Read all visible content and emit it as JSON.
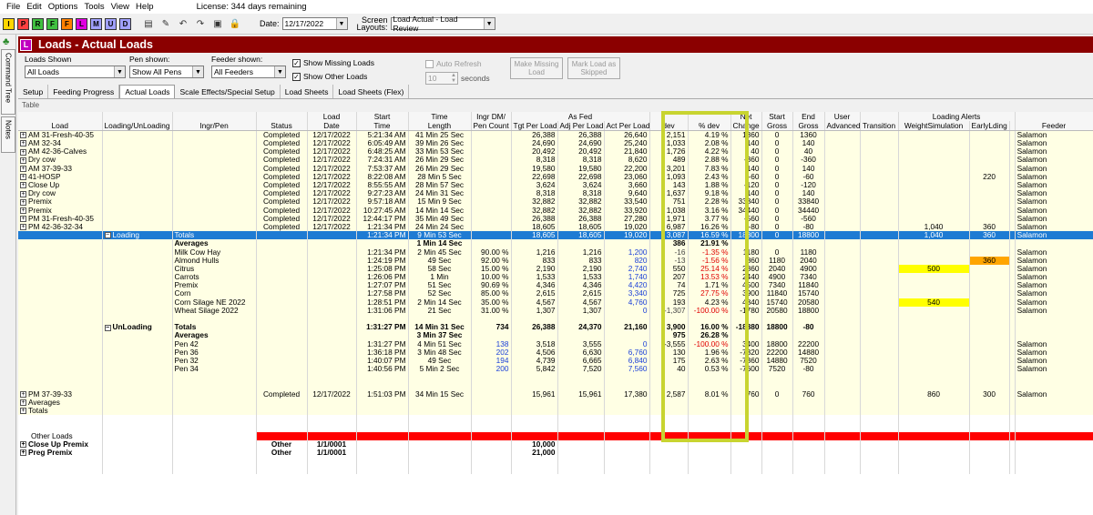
{
  "menu": {
    "file": "File",
    "edit": "Edit",
    "options": "Options",
    "tools": "Tools",
    "view": "View",
    "help": "Help",
    "license": "License: 344 days remaining"
  },
  "toolbar": {
    "buttons": [
      "I",
      "P",
      "R",
      "F",
      "F",
      "L",
      "M",
      "U",
      "D"
    ],
    "date_label": "Date:",
    "date_value": "12/17/2022",
    "screen_label1": "Screen",
    "screen_label2": "Layouts:",
    "screen_value": "Load Actual - Load Review"
  },
  "sidebar": {
    "command_tree": "Command Tree",
    "notes": "Notes"
  },
  "window": {
    "title": "Loads - Actual Loads",
    "icon": "L"
  },
  "filters": {
    "loads_shown_label": "Loads Shown",
    "loads_shown_value": "All Loads",
    "pen_shown_label": "Pen shown:",
    "pen_shown_value": "Show All Pens",
    "feeder_shown_label": "Feeder shown:",
    "feeder_shown_value": "All Feeders",
    "show_missing": "Show Missing Loads",
    "show_other": "Show Other Loads",
    "auto_refresh": "Auto Refresh",
    "interval_value": "10",
    "seconds": "seconds",
    "make_missing": "Make Missing Load",
    "mark_skipped": "Mark Load as Skipped"
  },
  "tabs": [
    "Setup",
    "Feeding Progress",
    "Actual Loads",
    "Scale Effects/Special Setup",
    "Load Sheets",
    "Load Sheets (Flex)"
  ],
  "section_label": "Table",
  "columns": {
    "h1": [
      "",
      "",
      "",
      "",
      "Load",
      "Start",
      "Time",
      "Ingr DM/",
      "As Fed",
      "",
      "",
      "",
      "Net",
      "Start",
      "End",
      "User",
      "",
      "Loading Alerts",
      "",
      "",
      "",
      ""
    ],
    "h2": [
      "Load",
      "Loading/UnLoading",
      "Ingr/Pen",
      "Status",
      "Date",
      "Time",
      "Length",
      "Pen Count",
      "Tgt Per Load",
      "Adj Per Load",
      "Act Per Load",
      "dev",
      "% dev",
      "Change",
      "Gross",
      "Gross",
      "Advanced",
      "Transition",
      "WeightSimulation",
      "EarlyLding",
      "",
      "Feeder"
    ]
  },
  "loads": [
    {
      "name": "AM 31-Fresh-40-35",
      "status": "Completed",
      "date": "12/17/2022",
      "time": "5:21:34 AM",
      "length": "41 Min 25 Sec",
      "tgt": "26,388",
      "adj": "26,388",
      "act": "26,640",
      "dev": "2,151",
      "pdev": "4.19 %",
      "net": "1360",
      "sg": "0",
      "eg": "1360",
      "feeder": "Salamon"
    },
    {
      "name": "AM 32-34",
      "status": "Completed",
      "date": "12/17/2022",
      "time": "6:05:49 AM",
      "length": "39 Min 26 Sec",
      "tgt": "24,690",
      "adj": "24,690",
      "act": "25,240",
      "dev": "1,033",
      "pdev": "2.08 %",
      "net": "140",
      "sg": "0",
      "eg": "140",
      "feeder": "Salamon"
    },
    {
      "name": "AM 42-36-Calves",
      "status": "Completed",
      "date": "12/17/2022",
      "time": "6:48:25 AM",
      "length": "33 Min 53 Sec",
      "tgt": "20,492",
      "adj": "20,492",
      "act": "21,840",
      "dev": "1,726",
      "pdev": "4.22 %",
      "net": "40",
      "sg": "0",
      "eg": "40",
      "feeder": "Salamon"
    },
    {
      "name": "Dry cow",
      "status": "Completed",
      "date": "12/17/2022",
      "time": "7:24:31 AM",
      "length": "26 Min 29 Sec",
      "tgt": "8,318",
      "adj": "8,318",
      "act": "8,620",
      "dev": "489",
      "pdev": "2.88 %",
      "net": "-360",
      "sg": "0",
      "eg": "-360",
      "feeder": "Salamon"
    },
    {
      "name": "AM 37-39-33",
      "status": "Completed",
      "date": "12/17/2022",
      "time": "7:53:37 AM",
      "length": "26 Min 29 Sec",
      "tgt": "19,580",
      "adj": "19,580",
      "act": "22,200",
      "dev": "3,201",
      "pdev": "7.83 %",
      "net": "140",
      "sg": "0",
      "eg": "140",
      "feeder": "Salamon"
    },
    {
      "name": "41-HOSP",
      "status": "Completed",
      "date": "12/17/2022",
      "time": "8:22:08 AM",
      "length": "28 Min 5 Sec",
      "tgt": "22,698",
      "adj": "22,698",
      "act": "23,060",
      "dev": "1,093",
      "pdev": "2.43 %",
      "net": "-60",
      "sg": "0",
      "eg": "-60",
      "early": "220",
      "feeder": "Salamon"
    },
    {
      "name": "Close Up",
      "status": "Completed",
      "date": "12/17/2022",
      "time": "8:55:55 AM",
      "length": "28 Min 57 Sec",
      "tgt": "3,624",
      "adj": "3,624",
      "act": "3,660",
      "dev": "143",
      "pdev": "1.88 %",
      "net": "-120",
      "sg": "0",
      "eg": "-120",
      "feeder": "Salamon"
    },
    {
      "name": "Dry cow",
      "status": "Completed",
      "date": "12/17/2022",
      "time": "9:27:23 AM",
      "length": "24 Min 31 Sec",
      "tgt": "8,318",
      "adj": "8,318",
      "act": "9,640",
      "dev": "1,637",
      "pdev": "9.18 %",
      "net": "140",
      "sg": "0",
      "eg": "140",
      "feeder": "Salamon"
    },
    {
      "name": "Premix",
      "status": "Completed",
      "date": "12/17/2022",
      "time": "9:57:18 AM",
      "length": "15 Min 9 Sec",
      "tgt": "32,882",
      "adj": "32,882",
      "act": "33,540",
      "dev": "751",
      "pdev": "2.28 %",
      "net": "33840",
      "sg": "0",
      "eg": "33840",
      "feeder": "Salamon"
    },
    {
      "name": "Premix",
      "status": "Completed",
      "date": "12/17/2022",
      "time": "10:27:45 AM",
      "length": "14 Min 14 Sec",
      "tgt": "32,882",
      "adj": "32,882",
      "act": "33,920",
      "dev": "1,038",
      "pdev": "3.16 %",
      "net": "34440",
      "sg": "0",
      "eg": "34440",
      "feeder": "Salamon"
    },
    {
      "name": "PM 31-Fresh-40-35",
      "status": "Completed",
      "date": "12/17/2022",
      "time": "12:44:17 PM",
      "length": "35 Min 49 Sec",
      "tgt": "26,388",
      "adj": "26,388",
      "act": "27,280",
      "dev": "1,971",
      "pdev": "3.77 %",
      "net": "-560",
      "sg": "0",
      "eg": "-560",
      "feeder": "Salamon"
    },
    {
      "name": "PM 42-36-32-34",
      "status": "Completed",
      "date": "12/17/2022",
      "time": "1:21:34 PM",
      "length": "24 Min 24 Sec",
      "tgt": "18,605",
      "adj": "18,605",
      "act": "19,020",
      "dev": "6,987",
      "pdev": "16.26 %",
      "net": "-80",
      "sg": "0",
      "eg": "-80",
      "wsim": "1,040",
      "early": "360",
      "feeder": "Salamon"
    }
  ],
  "loading": {
    "label": "Loading",
    "totals": "Totals",
    "time": "1:21:34 PM",
    "length": "9 Min 53 Sec",
    "tgt": "18,605",
    "adj": "18,605",
    "act": "19,020",
    "dev": "3,087",
    "pdev": "16.59 %",
    "net": "18800",
    "sg": "0",
    "eg": "18800",
    "wsim": "1,040",
    "early": "360",
    "feeder": "Salamon",
    "avg_label": "Averages",
    "avg_length": "1 Min 14 Sec",
    "avg_dev": "386",
    "avg_pdev": "21.91 %"
  },
  "ingredients": [
    {
      "name": "Milk Cow Hay",
      "time": "1:21:34 PM",
      "length": "2 Min 45 Sec",
      "pct": "90.00 %",
      "tgt": "1,216",
      "adj": "1,216",
      "act": "1,200",
      "dev": "-16",
      "pdev": "-1.35 %",
      "net": "1180",
      "sg": "0",
      "eg": "1180",
      "feeder": "Salamon"
    },
    {
      "name": "Almond Hulls",
      "time": "1:24:19 PM",
      "length": "49 Sec",
      "pct": "92.00 %",
      "tgt": "833",
      "adj": "833",
      "act": "820",
      "dev": "-13",
      "pdev": "-1.56 %",
      "net": "860",
      "sg": "1180",
      "eg": "2040",
      "early": "360",
      "feeder": "Salamon"
    },
    {
      "name": "Citrus",
      "time": "1:25:08 PM",
      "length": "58 Sec",
      "pct": "15.00 %",
      "tgt": "2,190",
      "adj": "2,190",
      "act": "2,740",
      "dev": "550",
      "pdev": "25.14 %",
      "net": "2860",
      "sg": "2040",
      "eg": "4900",
      "wsim": "500",
      "feeder": "Salamon"
    },
    {
      "name": "Carrots",
      "time": "1:26:06 PM",
      "length": "1 Min",
      "pct": "10.00 %",
      "tgt": "1,533",
      "adj": "1,533",
      "act": "1,740",
      "dev": "207",
      "pdev": "13.53 %",
      "net": "2440",
      "sg": "4900",
      "eg": "7340",
      "feeder": "Salamon"
    },
    {
      "name": "Premix",
      "time": "1:27:07 PM",
      "length": "51 Sec",
      "pct": "90.69 %",
      "tgt": "4,346",
      "adj": "4,346",
      "act": "4,420",
      "dev": "74",
      "pdev": "1.71 %",
      "net": "4500",
      "sg": "7340",
      "eg": "11840",
      "feeder": "Salamon"
    },
    {
      "name": "Corn",
      "time": "1:27:58 PM",
      "length": "52 Sec",
      "pct": "85.00 %",
      "tgt": "2,615",
      "adj": "2,615",
      "act": "3,340",
      "dev": "725",
      "pdev": "27.75 %",
      "net": "3900",
      "sg": "11840",
      "eg": "15740",
      "feeder": "Salamon"
    },
    {
      "name": "Corn Silage NE 2022",
      "time": "1:28:51 PM",
      "length": "2 Min 14 Sec",
      "pct": "35.00 %",
      "tgt": "4,567",
      "adj": "4,567",
      "act": "4,760",
      "dev": "193",
      "pdev": "4.23 %",
      "net": "4840",
      "sg": "15740",
      "eg": "20580",
      "wsim": "540",
      "feeder": "Salamon"
    },
    {
      "name": "Wheat Silage 2022",
      "time": "1:31:06 PM",
      "length": "21 Sec",
      "pct": "31.00 %",
      "tgt": "1,307",
      "adj": "1,307",
      "act": "0",
      "dev": "-1,307",
      "pdev": "-100.00 %",
      "net": "-1780",
      "sg": "20580",
      "eg": "18800",
      "feeder": "Salamon"
    }
  ],
  "unloading": {
    "label": "UnLoading",
    "totals": "Totals",
    "time": "1:31:27 PM",
    "length": "14 Min 31 Sec",
    "pen_count": "734",
    "tgt": "26,388",
    "adj": "24,370",
    "act": "21,160",
    "dev": "3,900",
    "pdev": "16.00 %",
    "net": "-18880",
    "sg": "18800",
    "eg": "-80",
    "avg_label": "Averages",
    "avg_length": "3 Min 37 Sec",
    "avg_dev": "975",
    "avg_pdev": "26.28 %"
  },
  "pens": [
    {
      "name": "Pen 42",
      "time": "1:31:27 PM",
      "length": "4 Min 51 Sec",
      "count": "138",
      "tgt": "3,518",
      "adj": "3,555",
      "act": "0",
      "dev": "-3,555",
      "pdev": "-100.00 %",
      "net": "3400",
      "sg": "18800",
      "eg": "22200",
      "feeder": "Salamon"
    },
    {
      "name": "Pen 36",
      "time": "1:36:18 PM",
      "length": "3 Min 48 Sec",
      "count": "202",
      "tgt": "4,506",
      "adj": "6,630",
      "act": "6,760",
      "dev": "130",
      "pdev": "1.96 %",
      "net": "-7320",
      "sg": "22200",
      "eg": "14880",
      "feeder": "Salamon"
    },
    {
      "name": "Pen 32",
      "time": "1:40:07 PM",
      "length": "49 Sec",
      "count": "194",
      "tgt": "4,739",
      "adj": "6,665",
      "act": "6,840",
      "dev": "175",
      "pdev": "2.63 %",
      "net": "-7360",
      "sg": "14880",
      "eg": "7520",
      "feeder": "Salamon"
    },
    {
      "name": "Pen 34",
      "time": "1:40:56 PM",
      "length": "5 Min 2 Sec",
      "count": "200",
      "tgt": "5,842",
      "adj": "7,520",
      "act": "7,560",
      "dev": "40",
      "pdev": "0.53 %",
      "net": "-7600",
      "sg": "7520",
      "eg": "-80",
      "feeder": "Salamon"
    }
  ],
  "last_load": {
    "name": "PM 37-39-33",
    "status": "Completed",
    "date": "12/17/2022",
    "time": "1:51:03 PM",
    "length": "34 Min 15 Sec",
    "tgt": "15,961",
    "adj": "15,961",
    "act": "17,380",
    "dev": "2,587",
    "pdev": "8.01 %",
    "net": "760",
    "sg": "0",
    "eg": "760",
    "wsim": "860",
    "early": "300",
    "feeder": "Salamon",
    "averages": "Averages",
    "totals": "Totals"
  },
  "other_loads": {
    "label": "Other Loads",
    "rows": [
      {
        "name": "Close Up Premix",
        "status": "Other",
        "date": "1/1/0001",
        "tgt": "10,000"
      },
      {
        "name": "Preg Premix",
        "status": "Other",
        "date": "1/1/0001",
        "tgt": "21,000"
      }
    ]
  },
  "colors": {
    "title_bg": "#8b0000",
    "selected_row": "#1e7bd3",
    "highlight_box": "#c8d430",
    "alert_yellow": "#ffff00",
    "alert_orange": "#ffa500",
    "neg_red": "#e00000"
  }
}
